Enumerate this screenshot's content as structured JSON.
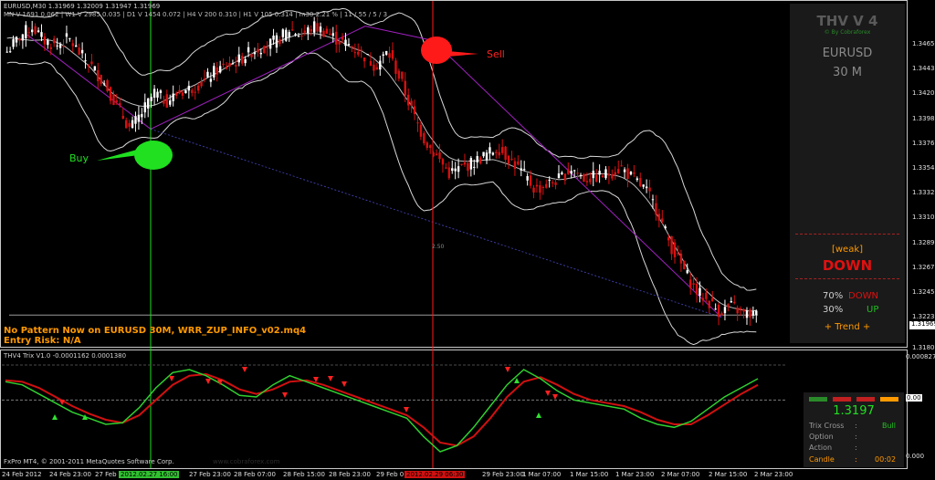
{
  "header": {
    "line1": "EURUSD,M30  1.31969 1.32009 1.31947 1.31969",
    "line2": "MN  V 1691  0.062  |  W1  V 2985  0.035  |  D1  V 1454  0.072  |  H4  V 200  0.310  |  H1  V 105  0.314  |  m30  2.21 %  |  11 / 55 / 5 / 3"
  },
  "signals": {
    "buy_label": "Buy",
    "sell_label": "Sell",
    "fib_label": "2.50"
  },
  "pattern": {
    "line1": "No Pattern Now on EURUSD 30M,  WRR_ZUP_INFO_v02.mq4",
    "line2": "Entry Risk: N/A"
  },
  "thv_panel": {
    "title": "THV V 4",
    "credit": "© By Cobraforex",
    "symbol": "EURUSD",
    "timeframe": "30 M",
    "weak": "[weak]",
    "direction": "DOWN",
    "down_pct": "70%",
    "down_label": "DOWN",
    "up_pct": "30%",
    "up_label": "UP",
    "trend": "+   Trend   +"
  },
  "trix_panel": {
    "price": "1.3197",
    "rows": [
      {
        "label": "Trix Cross",
        "sep": ":",
        "value": "Bull"
      },
      {
        "label": "Option",
        "sep": ":",
        "value": ""
      },
      {
        "label": "Action",
        "sep": ":",
        "value": ""
      },
      {
        "label": "Candle",
        "sep": ":",
        "value": "00:02"
      }
    ],
    "bar_colors": [
      "#2a8a2a",
      "#c02020",
      "#c02020",
      "#ff9900"
    ]
  },
  "indicator": {
    "title": "THV4 Trix V1.0 -0.0001162 0.0001380"
  },
  "footer": {
    "copyright": "FxPro MT4, © 2001-2011 MetaQuotes Software Corp.",
    "watermark": "www.cobraforex.com"
  },
  "price_axis": {
    "ticks": [
      "1.34650",
      "1.34435",
      "1.34205",
      "1.33985",
      "1.33760",
      "1.33545",
      "1.33325",
      "1.33100",
      "1.32890",
      "1.32675",
      "1.32455",
      "1.32235",
      "1.31800"
    ],
    "current": "1.31969"
  },
  "indicator_axis": {
    "ticks": [
      "0.000827",
      "0.00",
      "0.000"
    ]
  },
  "time_axis": {
    "labels": [
      "24 Feb 2012",
      "24 Feb 23:00",
      "27 Feb",
      "2012.02.27 16:00",
      "27 Feb 23:00",
      "28 Feb 07:00",
      "28 Feb 15:00",
      "28 Feb 23:00",
      "29 Feb 0",
      "2012.02.29 06:30",
      "29 Feb 23:00",
      "1 Mar 07:00",
      "1 Mar 15:00",
      "1 Mar 23:00",
      "2 Mar 07:00",
      "2 Mar 15:00",
      "2 Mar 23:00"
    ],
    "highlight_green": "2012.02.27 16:00",
    "highlight_red": "2012.02.29 06:30"
  },
  "colors": {
    "bull": "#ffffff",
    "bear": "#d81010",
    "buy": "#20e020",
    "sell": "#ff1a1a",
    "trend_line": "#a020c0",
    "orange": "#ff9900"
  },
  "chart_data": {
    "type": "candlestick",
    "symbol": "EURUSD",
    "timeframe": "M30",
    "ylim": [
      1.317,
      1.3475
    ],
    "close_path": [
      1.3435,
      1.3448,
      1.3458,
      1.3445,
      1.344,
      1.3447,
      1.3432,
      1.342,
      1.3405,
      1.3385,
      1.3365,
      1.338,
      1.3398,
      1.339,
      1.3398,
      1.3402,
      1.3408,
      1.3418,
      1.3422,
      1.3428,
      1.3436,
      1.344,
      1.3445,
      1.3455,
      1.345,
      1.3458,
      1.3452,
      1.3445,
      1.344,
      1.3432,
      1.3422,
      1.3435,
      1.341,
      1.338,
      1.3355,
      1.334,
      1.3325,
      1.333,
      1.3335,
      1.3342,
      1.3348,
      1.3337,
      1.3325,
      1.331,
      1.3315,
      1.332,
      1.333,
      1.332,
      1.3322,
      1.3325,
      1.333,
      1.332,
      1.331,
      1.329,
      1.326,
      1.324,
      1.322,
      1.321,
      1.32,
      1.3205,
      1.3198,
      1.3197
    ],
    "trix": [
      0.00012,
      0.0001,
      4e-05,
      -2e-05,
      -8e-05,
      -0.00012,
      -0.00016,
      -0.00015,
      -5e-05,
      8e-05,
      0.00018,
      0.0002,
      0.00016,
      0.0001,
      3e-05,
      2e-05,
      0.0001,
      0.00016,
      0.00012,
      8e-05,
      4e-05,
      0.0,
      -4e-05,
      -8e-05,
      -0.00012,
      -0.00024,
      -0.00034,
      -0.0003,
      -0.00018,
      -4e-05,
      0.0001,
      0.0002,
      0.00014,
      6e-05,
      0.0,
      -2e-05,
      -4e-05,
      -6e-05,
      -0.00012,
      -0.00016,
      -0.00018,
      -0.00014,
      -6e-05,
      2e-05,
      8e-05,
      0.00014
    ],
    "trix_signal": [
      0.00013,
      0.00012,
      8e-05,
      2e-05,
      -4e-05,
      -9e-05,
      -0.00013,
      -0.00015,
      -0.0001,
      0.0,
      0.0001,
      0.00016,
      0.00017,
      0.00013,
      7e-05,
      4e-05,
      7e-05,
      0.00012,
      0.00013,
      0.0001,
      6e-05,
      2e-05,
      -2e-05,
      -6e-05,
      -0.0001,
      -0.00018,
      -0.00028,
      -0.0003,
      -0.00024,
      -0.00012,
      2e-05,
      0.00012,
      0.00015,
      0.0001,
      4e-05,
      0.0,
      -2e-05,
      -4e-05,
      -8e-05,
      -0.00013,
      -0.00016,
      -0.00016,
      -0.0001,
      -3e-05,
      4e-05,
      0.0001
    ]
  }
}
